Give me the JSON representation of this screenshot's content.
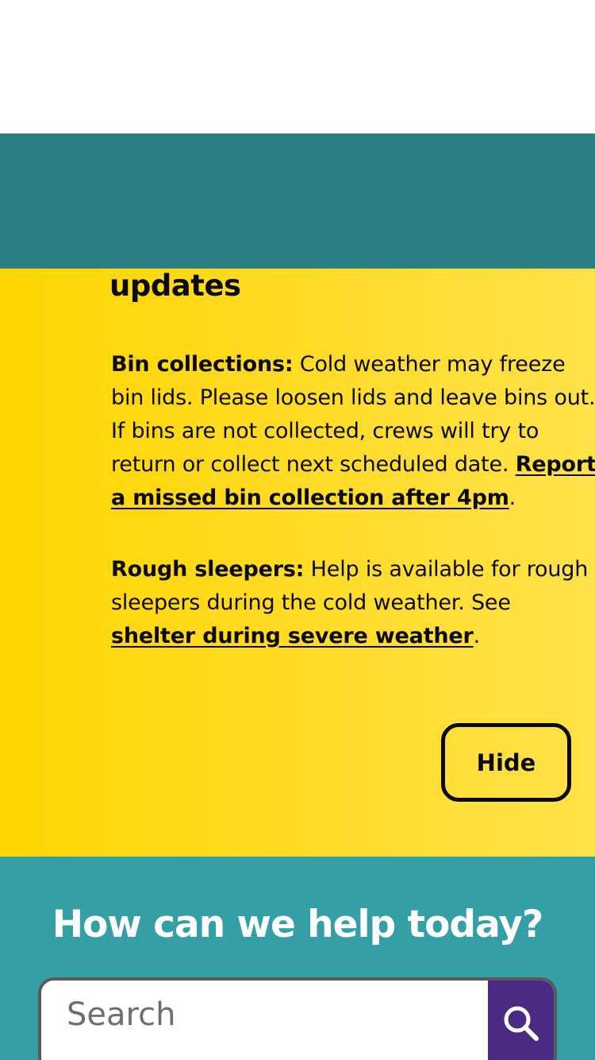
{
  "alert": {
    "title": "updates",
    "bin": {
      "heading": "Bin collections:",
      "text": " Cold weather may freeze bin lids. Please loosen lids and leave bins out. If bins are not collected, crews will try to return or collect next scheduled date. ",
      "link": "Report a missed bin collection after 4pm",
      "end": "."
    },
    "rough": {
      "heading": "Rough sleepers:",
      "text": " Help is available for rough sleepers during the cold weather. See ",
      "link": "shelter during severe weather",
      "end": "."
    },
    "hide_label": "Hide"
  },
  "help": {
    "heading": "How can we help today?",
    "search_placeholder": "Search",
    "search_icon": "search-icon"
  },
  "colors": {
    "teal_band": "#2a7f82",
    "alert_yellow": "#ffd600",
    "help_teal": "#359fa6",
    "search_button": "#4b2a84"
  }
}
